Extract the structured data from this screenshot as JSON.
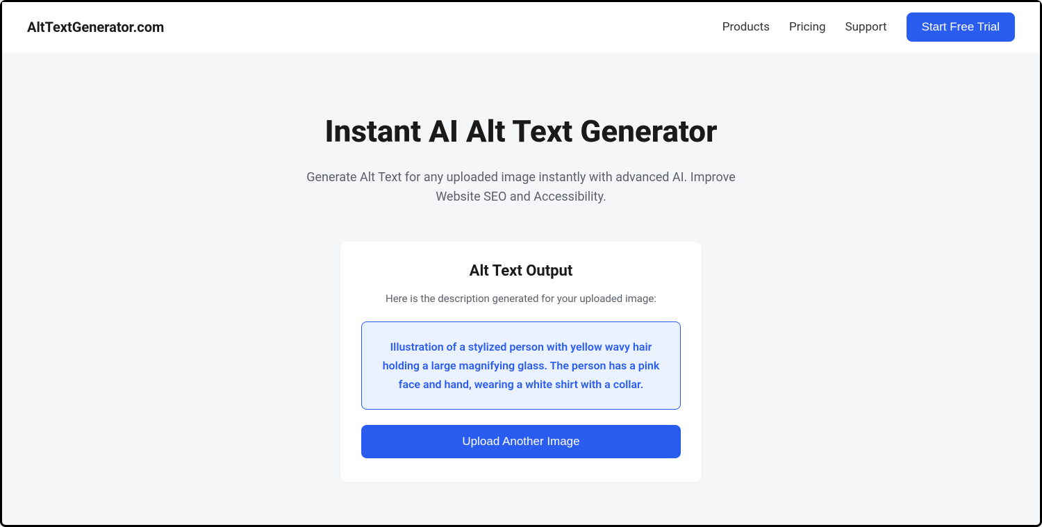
{
  "header": {
    "brand": "AltTextGenerator.com",
    "nav": {
      "products": "Products",
      "pricing": "Pricing",
      "support": "Support"
    },
    "cta": "Start Free Trial"
  },
  "main": {
    "title": "Instant AI Alt Text Generator",
    "subtitle": "Generate Alt Text for any uploaded image instantly with advanced AI. Improve Website SEO and Accessibility."
  },
  "card": {
    "title": "Alt Text Output",
    "subtitle": "Here is the description generated for your uploaded image:",
    "output": "Illustration of a stylized person with yellow wavy hair holding a large magnifying glass. The person has a pink face and hand, wearing a white shirt with a collar.",
    "upload_button": "Upload Another Image"
  }
}
